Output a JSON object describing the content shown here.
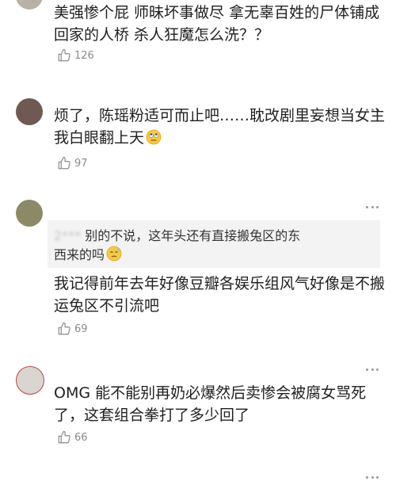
{
  "comments": [
    {
      "lines": [
        "美强惨个屁  师昧坏事做尽  拿无辜百姓的尸体铺成",
        "回家的人桥  杀人狂魔怎么洗？？"
      ],
      "likes": "126"
    },
    {
      "lines": [
        "烦了，陈瑶粉适可而止吧……耽改剧里妄想当女主",
        "我白眼翻上天"
      ],
      "emoji": "eye-roll-emoji",
      "likes": "97"
    },
    {
      "quote_user": "2***",
      "quote_lines": [
        "别的不说，这年头还有直接搬兔区的东",
        "西来的吗"
      ],
      "quote_emoji": "sweat-emoji",
      "lines": [
        "我记得前年去年好像豆瓣各娱乐组风气好像是不搬",
        "运兔区不引流吧"
      ],
      "likes": "69"
    },
    {
      "lines": [
        "OMG 能不能别再奶必爆然后卖惨会被腐女骂死",
        "了，这套组合拳打了多少回了"
      ],
      "likes": "66"
    }
  ],
  "colors": {
    "text": "#1f1f1f",
    "muted": "#8a8a8a",
    "quote_bg": "#f3f3f3",
    "divider": "#ececec"
  },
  "icons": {
    "like": "thumbs-up-icon",
    "more": "more-dots-icon"
  }
}
